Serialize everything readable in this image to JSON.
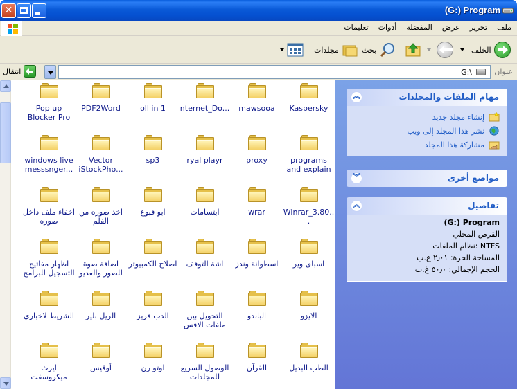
{
  "window": {
    "title": "(G:) Program",
    "buttons": {
      "close": "✕",
      "maximize": "",
      "minimize": ""
    }
  },
  "menu": [
    "ملف",
    "تحرير",
    "عرض",
    "المفضلة",
    "أدوات",
    "تعليمات"
  ],
  "toolbar": {
    "back_label": "الخلف",
    "search_label": "بحث",
    "folders_label": "مجلدات"
  },
  "address": {
    "label": "عنوان",
    "value": "G:\\",
    "go_label": "انتقال"
  },
  "taskpane": {
    "tasks": {
      "title": "مهام الملفات والمجلدات",
      "links": [
        "إنشاء مجلد جديد",
        "نشر هذا المجلد إلى ويب",
        "مشاركة هذا المجلد"
      ]
    },
    "other_places": {
      "title": "مواضع أخرى"
    },
    "details": {
      "title": "تفاصيل",
      "drive_name": "(G:) Program",
      "drive_type": "القرص المحلي",
      "filesystem": "نظام الملفات: NTFS",
      "free_space": "المساحة الحرة: ٢٫٠١ غ.ب",
      "total_size": "الحجم الإجمالي: ٥٠٫٠ غ.ب"
    }
  },
  "folders": [
    [
      "Kaspersky",
      "mawsooa",
      "nternet_Do...",
      "oll in 1",
      "PDF2Word",
      "Pop up Blocker Pro"
    ],
    [
      "programs and explain",
      "proxy",
      "ryal playr",
      "sp3",
      "Vector iStockPho...",
      "windows live messsnger..."
    ],
    [
      "Winrar_3.80...",
      "wrar",
      "ابتسامات",
      "ابو قبوع",
      "أخذ صوره من الفلم",
      "اخفاء ملف داخل صوره"
    ],
    [
      "اسباى وير",
      "اسطوانة وندز",
      "اشة التوقف",
      "اصلاح الكمبيوتر",
      "اضافة صوة للصور والفديو",
      "أظهار مفاتيح التسجيل للبرامج"
    ],
    [
      "الايزو",
      "الباندو",
      "التحويل بين ملفات الافس",
      "الدب فريز",
      "الريل بلير",
      "الشريط لاخباري"
    ],
    [
      "الطب البديل",
      "القرآن",
      "الوصول السريع للمجلدات",
      "اوتو رن",
      "أوفيس",
      "ايرث ميكروسفت"
    ]
  ]
}
